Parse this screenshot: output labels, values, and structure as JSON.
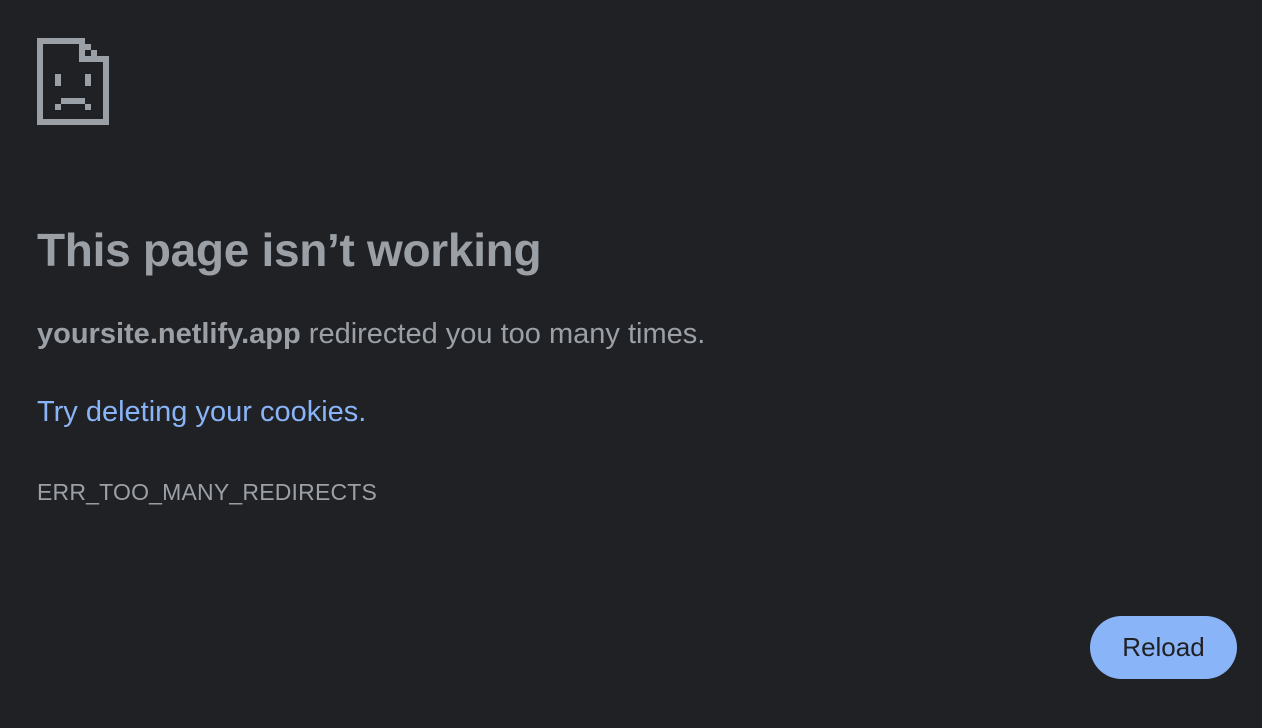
{
  "icon": "sad-document-icon",
  "title": "This page isn’t working",
  "summary": {
    "domain": "yoursite.netlify.app",
    "message": " redirected you too many times."
  },
  "suggestion": {
    "link_text": "Try deleting your cookies",
    "suffix": "."
  },
  "error_code": "ERR_TOO_MANY_REDIRECTS",
  "reload_label": "Reload",
  "colors": {
    "background": "#202124",
    "text": "#9aa0a6",
    "link": "#8ab4f8",
    "button": "#8ab4f8"
  }
}
